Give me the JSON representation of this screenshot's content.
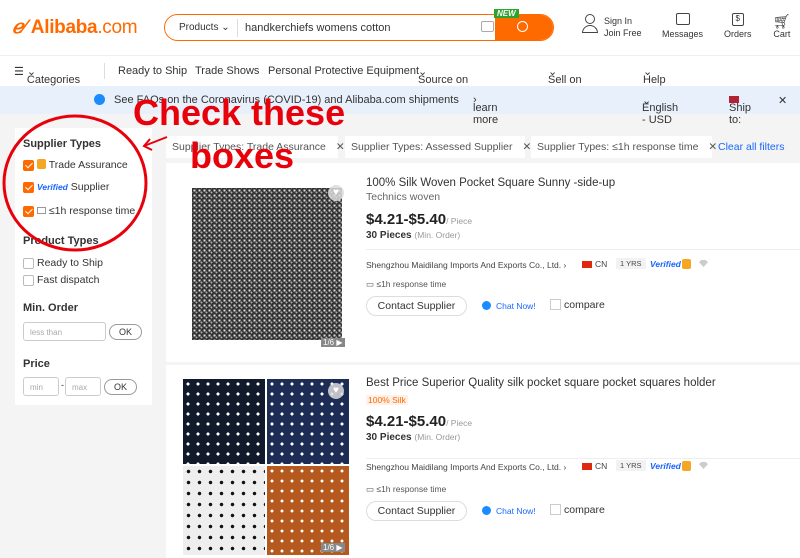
{
  "header": {
    "logo": "Alibaba",
    "logo_suffix": ".com",
    "search_category": "Products",
    "search_value": "handkerchiefs womens cotton",
    "new_badge": "NEW",
    "sign_in": "Sign In",
    "join_free": "Join Free",
    "messages": "Messages",
    "orders": "Orders",
    "cart": "Cart"
  },
  "nav": {
    "categories": "Categories",
    "items": [
      "Ready to Ship",
      "Trade Shows",
      "Personal Protective Equipment",
      "Source on Alibaba.com",
      "Sell on Alibaba",
      "Help"
    ]
  },
  "banner": {
    "text": "See FAQs on the Coronavirus (COVID-19) and Alibaba.com shipments",
    "link": "learn more",
    "language": "English - USD",
    "ship_to": "Ship to:"
  },
  "sidebar": {
    "supplier_types": "Supplier Types",
    "supplier_options": [
      {
        "label": "Trade Assurance",
        "checked": true
      },
      {
        "label": "Supplier",
        "prefix": "Verified",
        "checked": true
      },
      {
        "label": "≤1h response time",
        "checked": true
      }
    ],
    "product_types": "Product Types",
    "product_options": [
      {
        "label": "Ready to Ship",
        "checked": false
      },
      {
        "label": "Fast dispatch",
        "checked": false
      }
    ],
    "min_order": "Min. Order",
    "min_order_placeholder": "less than",
    "ok": "OK",
    "price": "Price",
    "price_min": "min",
    "price_max": "max"
  },
  "filters": {
    "chips": [
      "Supplier Types: Trade Assurance",
      "Supplier Types: Assessed Supplier",
      "Supplier Types: ≤1h response time"
    ],
    "clear": "Clear all filters"
  },
  "products": [
    {
      "title": "100% Silk Woven Pocket Square Sunny -side-up",
      "subtitle": "Technics woven",
      "price": "$4.21-$5.40",
      "unit": "/ Piece",
      "moq": "30 Pieces",
      "moq_note": "(Min. Order)",
      "company": "Shengzhou Maidilang Imports And Exports Co., Ltd.",
      "country": "CN",
      "years": "1 YRS",
      "verified": "Verified",
      "response": "≤1h response time",
      "contact": "Contact Supplier",
      "chat": "Chat Now!",
      "compare": "compare",
      "pager": "1/6"
    },
    {
      "title": "Best Price Superior Quality silk pocket square pocket squares holder",
      "subtitle": "100% Silk",
      "price": "$4.21-$5.40",
      "unit": "/ Piece",
      "moq": "30 Pieces",
      "moq_note": "(Min. Order)",
      "company": "Shengzhou Maidilang Imports And Exports Co., Ltd.",
      "country": "CN",
      "years": "1 YRS",
      "verified": "Verified",
      "response": "≤1h response time",
      "contact": "Contact Supplier",
      "chat": "Chat Now!",
      "compare": "compare",
      "pager": "1/6"
    }
  ],
  "annotation": {
    "line1": "Check these",
    "line2": "boxes",
    "color": "#e8000b"
  },
  "colors": {
    "brand": "#ff6a00",
    "link": "#1a66ff"
  }
}
